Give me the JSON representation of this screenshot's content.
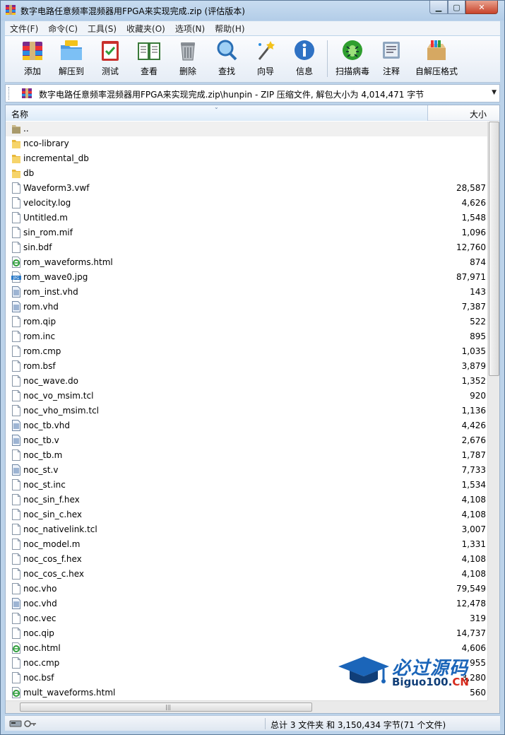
{
  "window": {
    "title": "数字电路任意频率混频器用FPGA来实现完成.zip (评估版本)"
  },
  "menu": [
    "文件(F)",
    "命令(C)",
    "工具(S)",
    "收藏夹(O)",
    "选项(N)",
    "帮助(H)"
  ],
  "toolbar": [
    {
      "label": "添加",
      "icon": "add-archive-icon"
    },
    {
      "label": "解压到",
      "icon": "extract-to-icon"
    },
    {
      "label": "测试",
      "icon": "test-icon"
    },
    {
      "label": "查看",
      "icon": "view-icon"
    },
    {
      "label": "删除",
      "icon": "delete-icon"
    },
    {
      "label": "查找",
      "icon": "find-icon"
    },
    {
      "label": "向导",
      "icon": "wizard-icon"
    },
    {
      "label": "信息",
      "icon": "info-icon"
    },
    {
      "label": "扫描病毒",
      "icon": "virus-scan-icon"
    },
    {
      "label": "注释",
      "icon": "comment-icon"
    },
    {
      "label": "自解压格式",
      "icon": "sfx-icon"
    }
  ],
  "address": {
    "path": "数字电路任意频率混频器用FPGA来实现完成.zip\\hunpin - ZIP 压缩文件, 解包大小为 4,014,471 字节"
  },
  "columns": {
    "name": "名称",
    "size": "大小"
  },
  "files": [
    {
      "name": "..",
      "size": "",
      "type": "up"
    },
    {
      "name": "nco-library",
      "size": "",
      "type": "folder"
    },
    {
      "name": "incremental_db",
      "size": "",
      "type": "folder"
    },
    {
      "name": "db",
      "size": "",
      "type": "folder"
    },
    {
      "name": "Waveform3.vwf",
      "size": "28,587",
      "type": "file"
    },
    {
      "name": "velocity.log",
      "size": "4,626",
      "type": "file"
    },
    {
      "name": "Untitled.m",
      "size": "1,548",
      "type": "file"
    },
    {
      "name": "sin_rom.mif",
      "size": "1,096",
      "type": "file"
    },
    {
      "name": "sin.bdf",
      "size": "12,760",
      "type": "file"
    },
    {
      "name": "rom_waveforms.html",
      "size": "874",
      "type": "html"
    },
    {
      "name": "rom_wave0.jpg",
      "size": "87,971",
      "type": "jpg"
    },
    {
      "name": "rom_inst.vhd",
      "size": "143",
      "type": "code"
    },
    {
      "name": "rom.vhd",
      "size": "7,387",
      "type": "code"
    },
    {
      "name": "rom.qip",
      "size": "522",
      "type": "file"
    },
    {
      "name": "rom.inc",
      "size": "895",
      "type": "file"
    },
    {
      "name": "rom.cmp",
      "size": "1,035",
      "type": "file"
    },
    {
      "name": "rom.bsf",
      "size": "3,879",
      "type": "file"
    },
    {
      "name": "noc_wave.do",
      "size": "1,352",
      "type": "file"
    },
    {
      "name": "noc_vo_msim.tcl",
      "size": "920",
      "type": "file"
    },
    {
      "name": "noc_vho_msim.tcl",
      "size": "1,136",
      "type": "file"
    },
    {
      "name": "noc_tb.vhd",
      "size": "4,426",
      "type": "code"
    },
    {
      "name": "noc_tb.v",
      "size": "2,676",
      "type": "code"
    },
    {
      "name": "noc_tb.m",
      "size": "1,787",
      "type": "file"
    },
    {
      "name": "noc_st.v",
      "size": "7,733",
      "type": "code"
    },
    {
      "name": "noc_st.inc",
      "size": "1,534",
      "type": "file"
    },
    {
      "name": "noc_sin_f.hex",
      "size": "4,108",
      "type": "file"
    },
    {
      "name": "noc_sin_c.hex",
      "size": "4,108",
      "type": "file"
    },
    {
      "name": "noc_nativelink.tcl",
      "size": "3,007",
      "type": "file"
    },
    {
      "name": "noc_model.m",
      "size": "1,331",
      "type": "file"
    },
    {
      "name": "noc_cos_f.hex",
      "size": "4,108",
      "type": "file"
    },
    {
      "name": "noc_cos_c.hex",
      "size": "4,108",
      "type": "file"
    },
    {
      "name": "noc.vho",
      "size": "79,549",
      "type": "file"
    },
    {
      "name": "noc.vhd",
      "size": "12,478",
      "type": "code"
    },
    {
      "name": "noc.vec",
      "size": "319",
      "type": "file"
    },
    {
      "name": "noc.qip",
      "size": "14,737",
      "type": "file"
    },
    {
      "name": "noc.html",
      "size": "4,606",
      "type": "html"
    },
    {
      "name": "noc.cmp",
      "size": "955",
      "type": "file"
    },
    {
      "name": "noc.bsf",
      "size": "3,280",
      "type": "file"
    },
    {
      "name": "mult_waveforms.html",
      "size": "560",
      "type": "html"
    }
  ],
  "watermark": {
    "cn": "必过源码",
    "en_main": "Biguo100.",
    "en_tail": "CN"
  },
  "status": {
    "summary": "总计 3 文件夹 和 3,150,434 字节(71 个文件)"
  }
}
